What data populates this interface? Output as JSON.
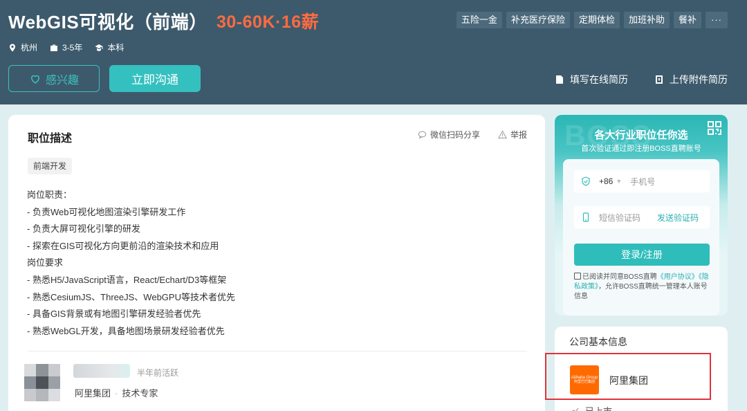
{
  "job": {
    "title": "WebGIS可视化（前端）",
    "salary": "30-60K·16薪",
    "benefits": [
      "五险一金",
      "补充医疗保险",
      "定期体检",
      "加班补助",
      "餐补"
    ],
    "more": "···",
    "location": "杭州",
    "experience": "3-5年",
    "education": "本科"
  },
  "actions": {
    "interest_label": "感兴趣",
    "chat_label": "立即沟通",
    "fill_resume_label": "填写在线简历",
    "upload_resume_label": "上传附件简历"
  },
  "description": {
    "title": "职位描述",
    "share_label": "微信扫码分享",
    "report_label": "举报",
    "tag": "前端开发",
    "lines": [
      "岗位职责：",
      "- 负责Web可视化地图渲染引擎研发工作",
      "- 负责大屏可视化引擎的研发",
      "- 探索在GIS可视化方向更前沿的渲染技术和应用",
      "岗位要求",
      "- 熟悉H5/JavaScript语言，React/Echart/D3等框架",
      "- 熟悉CesiumJS、ThreeJS、WebGPU等技术者优先",
      "- 具备GIS背景或有地图引擎研发经验者优先",
      "- 熟悉WebGL开发，具备地图场景研发经验者优先"
    ]
  },
  "recruiter": {
    "active": "半年前活跃",
    "company": "阿里集团",
    "role": "技术专家",
    "separator": "·"
  },
  "login": {
    "watermark": "BOSS",
    "title": "各大行业职位任你选",
    "subtitle": "首次验证通过即注册BOSS直聘账号",
    "country_code": "+86",
    "phone_placeholder": "手机号",
    "code_placeholder": "短信验证码",
    "send_code_label": "发送验证码",
    "submit_label": "登录/注册",
    "agree_prefix": "已阅读并同意BOSS直聘",
    "user_agreement": "《用户协议》",
    "privacy_policy": "《隐私政策》",
    "agree_suffix": "，允许BOSS直聘统一管理本人账号信息"
  },
  "company": {
    "section_title": "公司基本信息",
    "name": "阿里集团",
    "logo_line1": "Alibaba Group",
    "logo_line2": "阿里巴巴集团",
    "partial_row": "已上市"
  },
  "colors": {
    "header_bg": "#3d5a6c",
    "accent": "#35c0c0",
    "salary": "#ff6b40",
    "highlight_box": "#e0323a",
    "page_bg": "#dfeff1"
  },
  "icons": {
    "location": "location-pin-icon",
    "experience": "briefcase-icon",
    "education": "graduation-cap-icon",
    "interest": "heart-icon",
    "fill_resume": "document-icon",
    "upload_resume": "upload-icon",
    "share": "wechat-chat-icon",
    "report": "warning-icon",
    "qr": "qr-code-icon",
    "phone": "shield-check-icon",
    "sms": "phone-icon"
  }
}
